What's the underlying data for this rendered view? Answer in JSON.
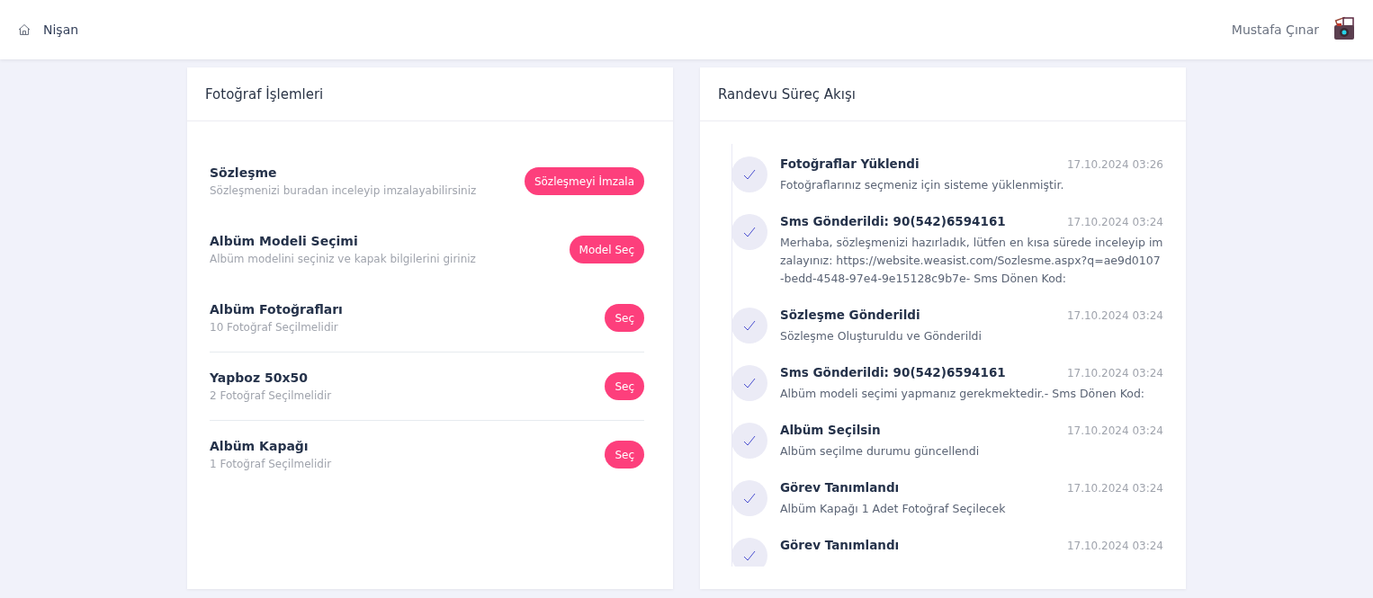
{
  "header": {
    "breadcrumb": "Nişan",
    "user_name": "Mustafa Çınar"
  },
  "photo_panel": {
    "title": "Fotoğraf İşlemleri",
    "items": [
      {
        "kind": "step",
        "title": "Sözleşme",
        "subtitle": "Sözleşmenizi buradan inceleyip imzalayabilirsiniz",
        "button": "Sözleşmeyi İmzala"
      },
      {
        "kind": "step",
        "title": "Albüm Modeli Seçimi",
        "subtitle": "Albüm modelini seçiniz ve kapak bilgilerini giriniz",
        "button": "Model Seç"
      },
      {
        "kind": "photo",
        "title": "Albüm Fotoğrafları",
        "subtitle": "10 Fotoğraf Seçilmelidir",
        "button": "Seç"
      },
      {
        "kind": "photo",
        "title": "Yapboz 50x50",
        "subtitle": "2 Fotoğraf Seçilmelidir",
        "button": "Seç"
      },
      {
        "kind": "photo",
        "title": "Albüm Kapağı",
        "subtitle": "1 Fotoğraf Seçilmelidir",
        "button": "Seç"
      }
    ]
  },
  "timeline_panel": {
    "title": "Randevu Süreç Akışı",
    "events": [
      {
        "title": "Fotoğraflar Yüklendi",
        "time": "17.10.2024 03:26",
        "text": "Fotoğraflarınız seçmeniz için sisteme yüklenmiştir."
      },
      {
        "title": "Sms Gönderildi: 90(542)6594161",
        "time": "17.10.2024 03:24",
        "text": "Merhaba, sözleşmenizi hazırladık, lütfen en kısa sürede inceleyip imzalayınız: https://website.weasist.com/Sozlesme.aspx?q=ae9d0107-bedd-4548-97e4-9e15128c9b7e- Sms Dönen Kod:"
      },
      {
        "title": "Sözleşme Gönderildi",
        "time": "17.10.2024 03:24",
        "text": "Sözleşme Oluşturuldu ve Gönderildi"
      },
      {
        "title": "Sms Gönderildi: 90(542)6594161",
        "time": "17.10.2024 03:24",
        "text": "Albüm modeli seçimi yapmanız gerekmektedir.- Sms Dönen Kod:"
      },
      {
        "title": "Albüm Seçilsin",
        "time": "17.10.2024 03:24",
        "text": "Albüm seçilme durumu güncellendi"
      },
      {
        "title": "Görev Tanımlandı",
        "time": "17.10.2024 03:24",
        "text": "Albüm Kapağı 1 Adet Fotoğraf Seçilecek"
      },
      {
        "title": "Görev Tanımlandı",
        "time": "17.10.2024 03:24"
      }
    ]
  }
}
